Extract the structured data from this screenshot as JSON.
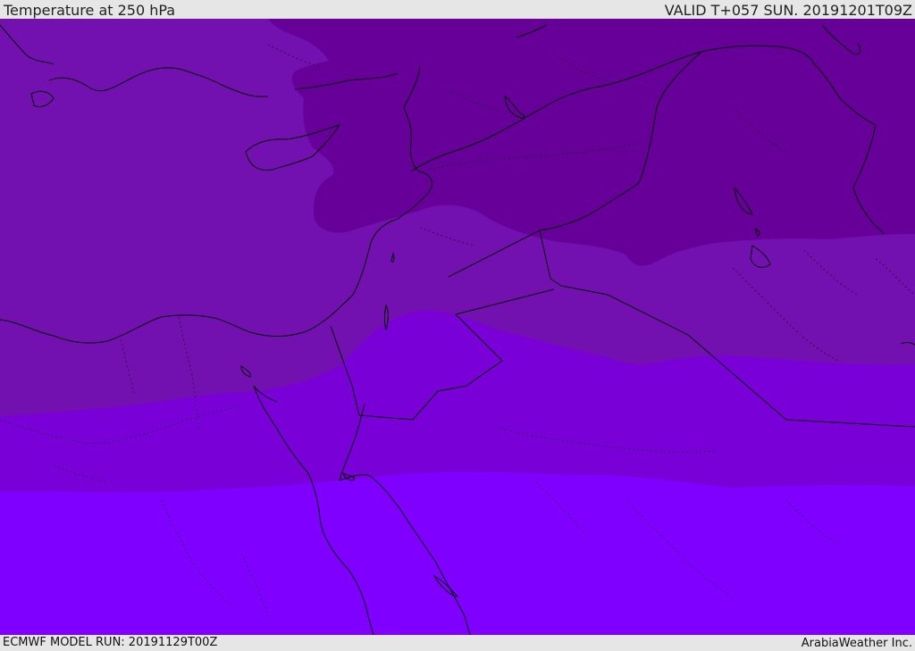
{
  "header": {
    "title": "Temperature at 250 hPa",
    "valid_time": "VALID T+057 SUN. 20191201T09Z"
  },
  "footer": {
    "model_run": "ECMWF MODEL RUN: 20191129T00Z",
    "credit": "ArabiaWeather Inc."
  },
  "colors": {
    "band_coldest": "#660099",
    "band_cold": "#7311b0",
    "band_mid": "#7a00d8",
    "band_warm": "#8000ff",
    "coast_line": "#000000",
    "border_line": "#000000",
    "frame_bg": "#e6e6e6"
  }
}
